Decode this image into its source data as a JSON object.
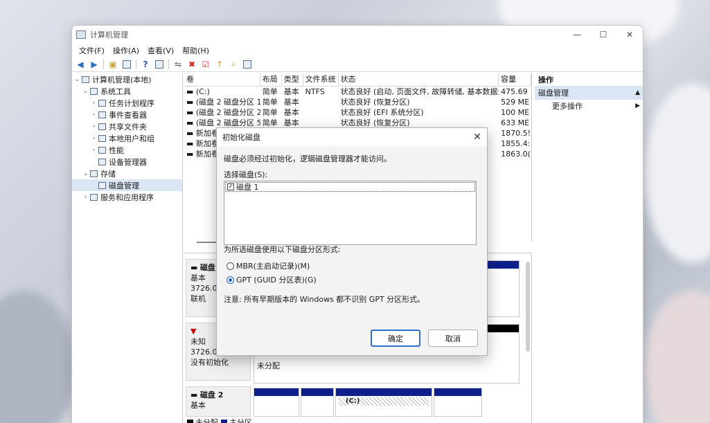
{
  "window": {
    "title": "计算机管理"
  },
  "menu": [
    "文件(F)",
    "操作(A)",
    "查看(V)",
    "帮助(H)"
  ],
  "tree": [
    {
      "label": "计算机管理(本地)",
      "indent": 0,
      "twisty": "v",
      "icon": "computer-icon"
    },
    {
      "label": "系统工具",
      "indent": 1,
      "twisty": "v",
      "icon": "tools-icon"
    },
    {
      "label": "任务计划程序",
      "indent": 2,
      "twisty": ">",
      "icon": "clock-icon"
    },
    {
      "label": "事件查看器",
      "indent": 2,
      "twisty": ">",
      "icon": "event-viewer-icon"
    },
    {
      "label": "共享文件夹",
      "indent": 2,
      "twisty": ">",
      "icon": "shared-folder-icon"
    },
    {
      "label": "本地用户和组",
      "indent": 2,
      "twisty": ">",
      "icon": "users-icon"
    },
    {
      "label": "性能",
      "indent": 2,
      "twisty": ">",
      "icon": "performance-icon"
    },
    {
      "label": "设备管理器",
      "indent": 2,
      "twisty": "",
      "icon": "device-manager-icon"
    },
    {
      "label": "存储",
      "indent": 1,
      "twisty": "v",
      "icon": "storage-icon"
    },
    {
      "label": "磁盘管理",
      "indent": 2,
      "twisty": "",
      "icon": "disk-icon",
      "selected": true
    },
    {
      "label": "服务和应用程序",
      "indent": 1,
      "twisty": ">",
      "icon": "services-icon"
    }
  ],
  "volume_list": {
    "columns": [
      "卷",
      "布局",
      "类型",
      "文件系统",
      "状态",
      "容量"
    ],
    "rows": [
      [
        "(C:)",
        "简单",
        "基本",
        "NTFS",
        "状态良好 (启动, 页面文件, 故障转储, 基本数据分区)",
        "475.69"
      ],
      [
        "(磁盘 2 磁盘分区 1)",
        "简单",
        "基本",
        "",
        "状态良好 (恢复分区)",
        "529 ME"
      ],
      [
        "(磁盘 2 磁盘分区 2)",
        "简单",
        "基本",
        "",
        "状态良好 (EFI 系统分区)",
        "100 ME"
      ],
      [
        "(磁盘 2 磁盘分区 5)",
        "简单",
        "基本",
        "",
        "状态良好 (恢复分区)",
        "633 ME"
      ],
      [
        "新加卷",
        "",
        "",
        "",
        "",
        "1870.5!"
      ],
      [
        "新加卷",
        "",
        "",
        "",
        "",
        "1855.4:"
      ],
      [
        "新加卷",
        "",
        "",
        "",
        "",
        "1863.0("
      ]
    ]
  },
  "disks": [
    {
      "name": "磁盘",
      "type": "基本",
      "size": "3726.02",
      "status": "联机"
    },
    {
      "name": "",
      "type": "未知",
      "size": "3726.02",
      "status": "没有初始化",
      "unallocated_label": "未分配"
    },
    {
      "name": "磁盘 2",
      "type": "基本",
      "part_label": "(C:)"
    }
  ],
  "legend": {
    "unallocated": "未分配",
    "primary": "主分区"
  },
  "actions": {
    "header": "操作",
    "sub": "磁盘管理",
    "item": "更多操作"
  },
  "dialog": {
    "title": "初始化磁盘",
    "desc": "磁盘必须经过初始化，逻辑磁盘管理器才能访问。",
    "select_label": "选择磁盘(S):",
    "disk_item": "磁盘 1",
    "style_label": "为所选磁盘使用以下磁盘分区形式:",
    "mbr": "MBR(主启动记录)(M)",
    "gpt": "GPT (GUID 分区表)(G)",
    "note": "注意: 所有早期版本的 Windows 都不识别 GPT 分区形式。",
    "ok": "确定",
    "cancel": "取消"
  },
  "colors": {
    "primary_partition": "#0d1f8a",
    "unallocated": "#000000",
    "selection": "#dbe6f4",
    "accent": "#1e66c5"
  }
}
